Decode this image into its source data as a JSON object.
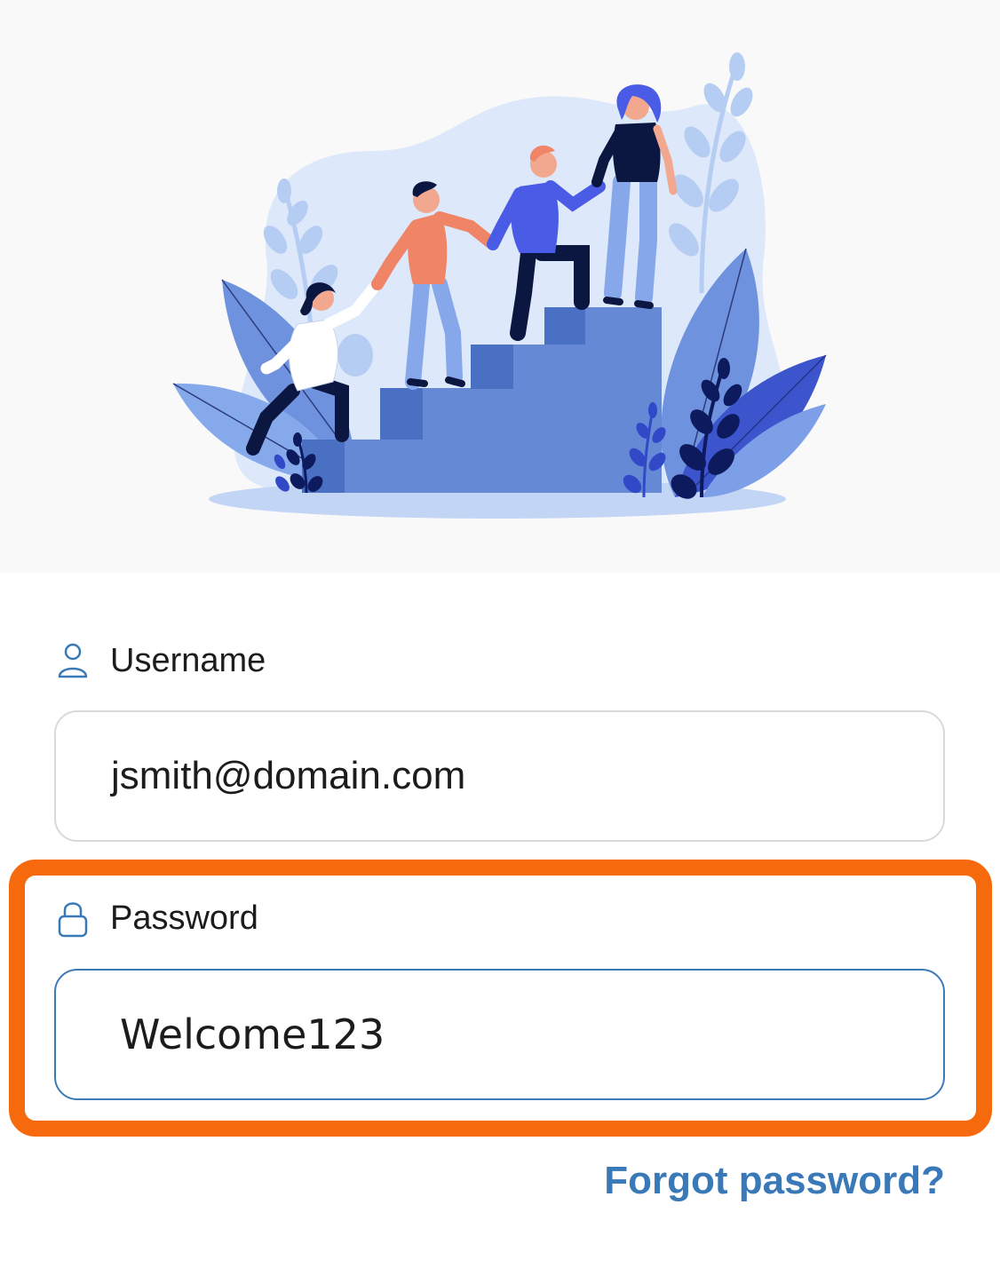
{
  "form": {
    "username": {
      "label": "Username",
      "value": "jsmith@domain.com",
      "icon": "user-icon"
    },
    "password": {
      "label": "Password",
      "value": "Welcome123",
      "icon": "lock-icon"
    },
    "forgot_label": "Forgot password?"
  },
  "colors": {
    "accent": "#3a79b8",
    "highlight": "#f6690d",
    "hero_background": "#f9f9fa",
    "input_border": "#d9d9dc",
    "input_focus_border": "#3d7ab8"
  }
}
